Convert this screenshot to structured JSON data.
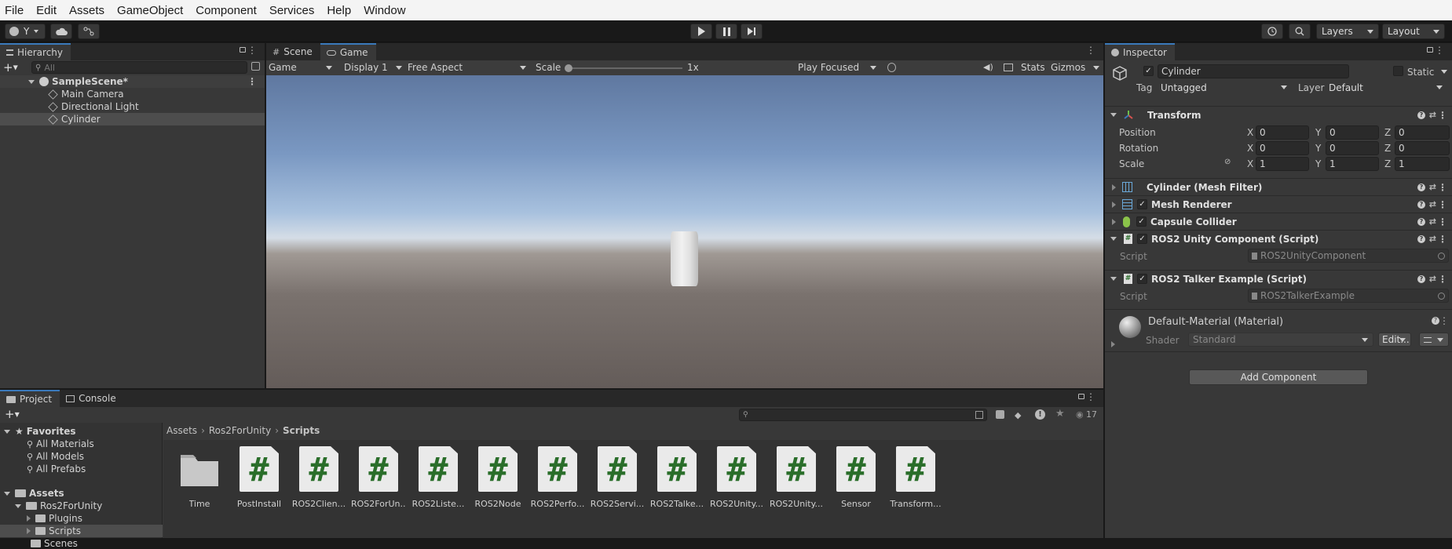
{
  "menu": [
    "File",
    "Edit",
    "Assets",
    "GameObject",
    "Component",
    "Services",
    "Help",
    "Window"
  ],
  "toolbar": {
    "account": "Y",
    "layers": "Layers",
    "layout": "Layout"
  },
  "hierarchy": {
    "tab": "Hierarchy",
    "search_placeholder": "All",
    "scene": "SampleScene*",
    "items": [
      "Main Camera",
      "Directional Light",
      "Cylinder"
    ]
  },
  "game": {
    "tabs": [
      "Scene",
      "Game"
    ],
    "mode": "Game",
    "display": "Display 1",
    "aspect": "Free Aspect",
    "scale_label": "Scale",
    "scale_value": "1x",
    "play_focused": "Play Focused",
    "stats": "Stats",
    "gizmos": "Gizmos"
  },
  "inspector": {
    "tab": "Inspector",
    "object_name": "Cylinder",
    "static_label": "Static",
    "tag_label": "Tag",
    "tag_value": "Untagged",
    "layer_label": "Layer",
    "layer_value": "Default",
    "transform": {
      "title": "Transform",
      "position_label": "Position",
      "rotation_label": "Rotation",
      "scale_label": "Scale",
      "position": [
        "0",
        "0",
        "0"
      ],
      "rotation": [
        "0",
        "0",
        "0"
      ],
      "scale": [
        "1",
        "1",
        "1"
      ],
      "axis": [
        "X",
        "Y",
        "Z"
      ]
    },
    "components": [
      "Cylinder (Mesh Filter)",
      "Mesh Renderer",
      "Capsule Collider",
      "ROS2 Unity Component (Script)",
      "ROS2 Talker Example (Script)"
    ],
    "script_label": "Script",
    "script1": "ROS2UnityComponent",
    "script2": "ROS2TalkerExample",
    "material_name": "Default-Material (Material)",
    "shader_label": "Shader",
    "shader_value": "Standard",
    "edit_button": "Edit...",
    "add_component": "Add Component"
  },
  "project": {
    "tabs": [
      "Project",
      "Console"
    ],
    "favorites_label": "Favorites",
    "favorites": [
      "All Materials",
      "All Models",
      "All Prefabs"
    ],
    "assets_label": "Assets",
    "tree": [
      "Ros2ForUnity",
      "Plugins",
      "Scripts",
      "Scenes"
    ],
    "breadcrumb": [
      "Assets",
      "Ros2ForUnity",
      "Scripts"
    ],
    "hidden_count": "17",
    "files": [
      "Time",
      "PostInstall",
      "ROS2Clien...",
      "ROS2ForUn...",
      "ROS2Liste...",
      "ROS2Node",
      "ROS2Perfo...",
      "ROS2Servi...",
      "ROS2Talke...",
      "ROS2Unity...",
      "ROS2Unity...",
      "Sensor",
      "Transform..."
    ]
  }
}
